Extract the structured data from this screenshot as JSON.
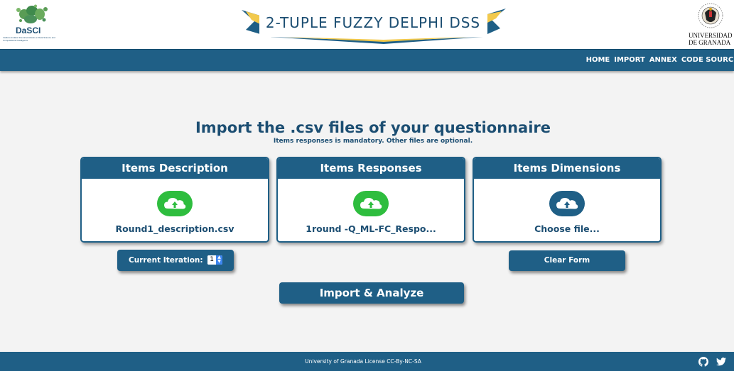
{
  "header": {
    "left_logo": {
      "name": "DaSCI",
      "subtitle": "Instituto Andaluz Interuniversitario en Data Science and Computational Intelligence"
    },
    "banner_title": "2-TUPLE FUZZY DELPHI DSS",
    "right_logo": {
      "line1": "UNIVERSIDAD",
      "line2": "DE GRANADA"
    }
  },
  "nav": {
    "items": [
      {
        "label": "HOME"
      },
      {
        "label": "IMPORT"
      },
      {
        "label": "ANNEX"
      },
      {
        "label": "CODE SOURCE"
      }
    ]
  },
  "main": {
    "title": "Import the .csv files of your questionnaire",
    "subtitle": "Items responses is mandatory. Other files are optional.",
    "panels": [
      {
        "title": "Items Description",
        "file_label": "Round1_description.csv",
        "icon": "cloud-upload-icon",
        "status_color": "#2ebd3e"
      },
      {
        "title": "Items Responses",
        "file_label": "1round -Q_ML-FC_Respo...",
        "icon": "cloud-upload-icon",
        "status_color": "#2ebd3e"
      },
      {
        "title": "Items Dimensions",
        "file_label": "Choose file...",
        "icon": "cloud-upload-icon",
        "status_color": "#1f5f86"
      }
    ],
    "iteration": {
      "label": "Current Iteration:",
      "value": "1"
    },
    "clear_label": "Clear Form",
    "import_label": "Import & Analyze"
  },
  "footer": {
    "text": "University of Granada License CC-By-NC-SA",
    "icons": [
      "github-icon",
      "twitter-icon"
    ]
  },
  "colors": {
    "primary": "#1f5f86",
    "success": "#2ebd3e",
    "background": "#f3f3f3"
  }
}
